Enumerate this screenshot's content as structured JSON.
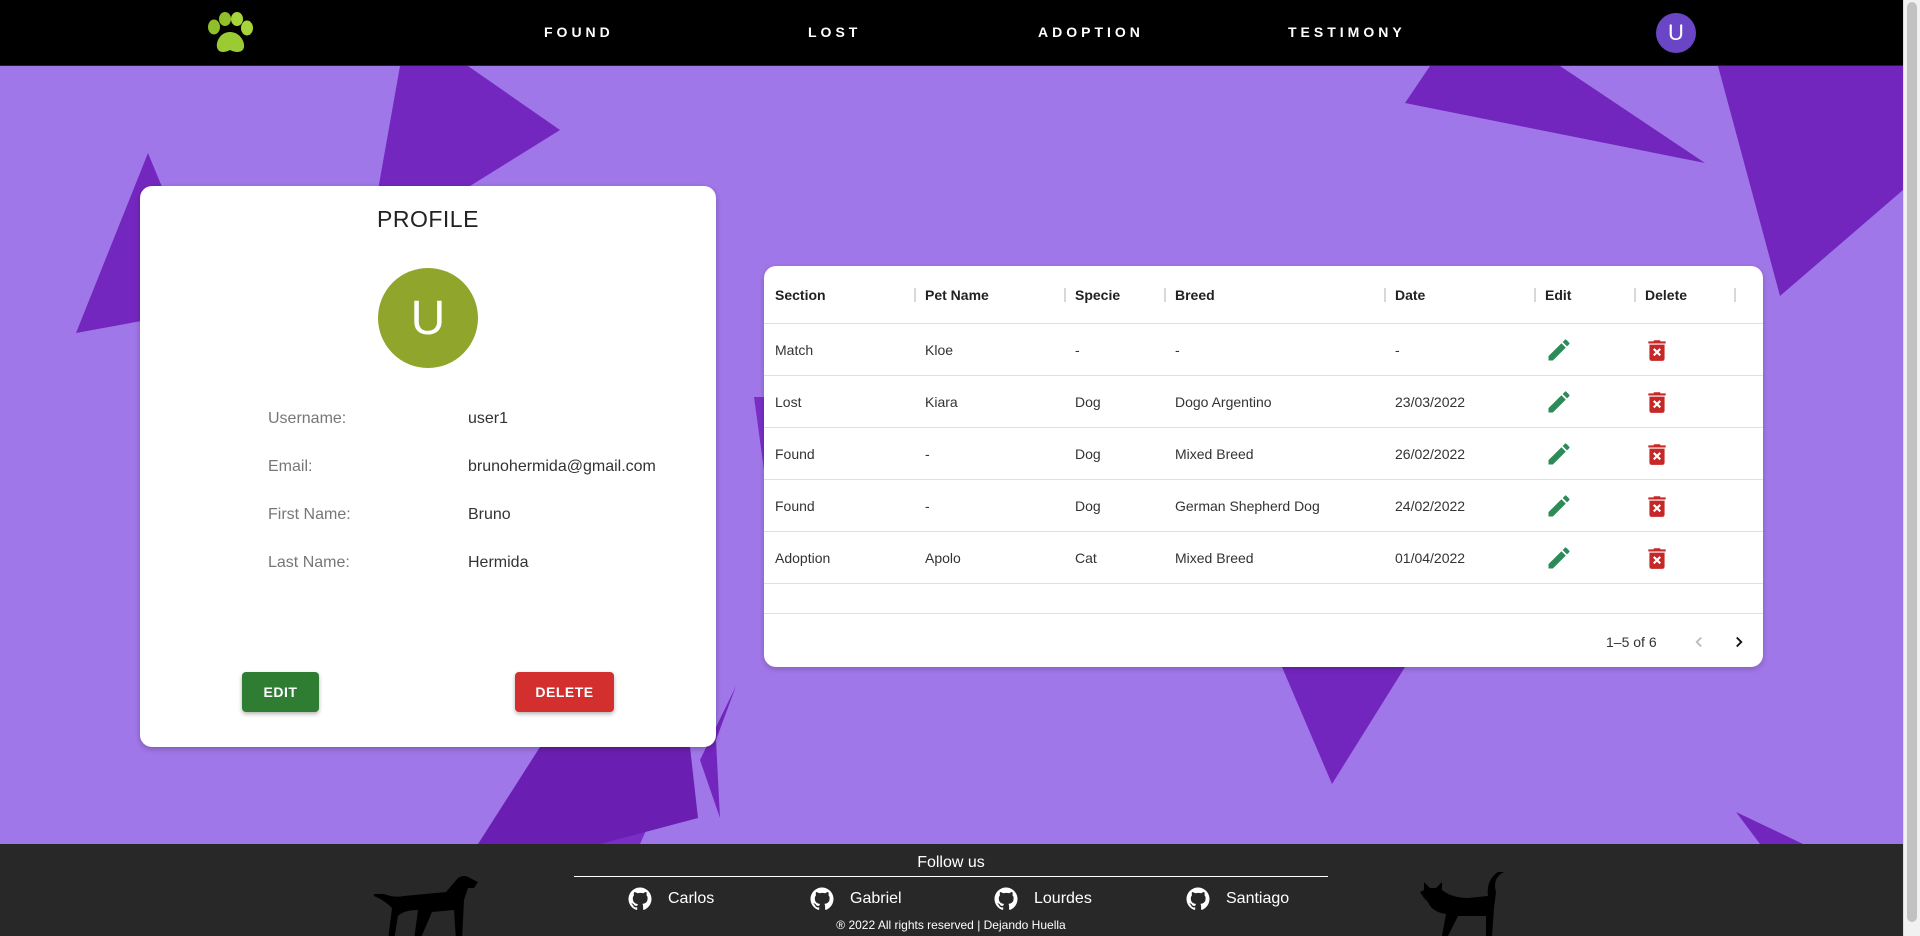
{
  "nav": {
    "links": [
      "FOUND",
      "LOST",
      "ADOPTION",
      "TESTIMONY"
    ],
    "avatar_initial": "U"
  },
  "profile": {
    "title": "PROFILE",
    "avatar_initial": "U",
    "fields": [
      {
        "label": "Username:",
        "value": "user1"
      },
      {
        "label": "Email:",
        "value": "brunohermida@gmail.com"
      },
      {
        "label": "First Name:",
        "value": "Bruno"
      },
      {
        "label": "Last Name:",
        "value": "Hermida"
      }
    ],
    "edit_label": "EDIT",
    "delete_label": "DELETE"
  },
  "table": {
    "columns": [
      "Section",
      "Pet Name",
      "Specie",
      "Breed",
      "Date",
      "Edit",
      "Delete"
    ],
    "rows": [
      {
        "section": "Match",
        "pet_name": "Kloe",
        "specie": "-",
        "breed": "-",
        "date": "-"
      },
      {
        "section": "Lost",
        "pet_name": "Kiara",
        "specie": "Dog",
        "breed": "Dogo Argentino",
        "date": "23/03/2022"
      },
      {
        "section": "Found",
        "pet_name": "-",
        "specie": "Dog",
        "breed": "Mixed Breed",
        "date": "26/02/2022"
      },
      {
        "section": "Found",
        "pet_name": "-",
        "specie": "Dog",
        "breed": "German Shepherd Dog",
        "date": "24/02/2022"
      },
      {
        "section": "Adoption",
        "pet_name": "Apolo",
        "specie": "Cat",
        "breed": "Mixed Breed",
        "date": "01/04/2022"
      }
    ],
    "pagination": "1–5 of 6"
  },
  "footer": {
    "follow_title": "Follow us",
    "socials": [
      "Carlos",
      "Gabriel",
      "Lourdes",
      "Santiago"
    ],
    "copyright": "® 2022 All rights reserved | Dejando Huella"
  },
  "colors": {
    "background": "#a077e8",
    "triangles": "#7226be",
    "edit_icon": "#2e8b57",
    "delete_icon": "#c62828",
    "avatar": "#8fa52b"
  },
  "icons": {
    "logo": "paw-icon",
    "edit": "pencil-icon",
    "delete": "trash-icon",
    "social": "github-icon"
  }
}
